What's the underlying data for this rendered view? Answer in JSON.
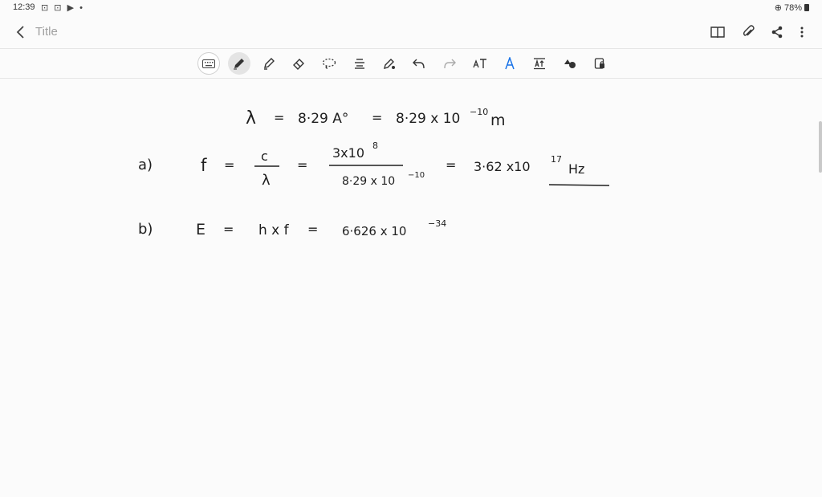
{
  "status_bar": {
    "time": "12:39",
    "notification_icons": [
      "screenshot-icon",
      "screenshot-icon",
      "play-store-icon",
      "dot"
    ],
    "battery_percent": "78%"
  },
  "header": {
    "title_placeholder": "Title",
    "icons": [
      "back-icon",
      "book-view-icon",
      "attach-icon",
      "share-icon",
      "more-icon"
    ]
  },
  "toolbar": {
    "tools": [
      "keyboard",
      "pen",
      "highlighter",
      "eraser",
      "lasso",
      "text-format",
      "pen-settings",
      "undo",
      "redo",
      "handwriting-to-text",
      "shape-recognition",
      "insert-space",
      "color-palette",
      "lock"
    ],
    "active_tool": "pen"
  },
  "note": {
    "line1": {
      "lhs": "λ",
      "eq1": "=",
      "value": "8·29 A°",
      "eq2": "=",
      "base": "8·29 x 10",
      "exp": "−10",
      "unit": "m"
    },
    "line_a": {
      "label": "a)",
      "lhs": "f",
      "eq1": "=",
      "frac_num": "c",
      "frac_den": "λ",
      "eq2": "=",
      "num_base": "3x10",
      "num_exp": "8",
      "den_base": "8·29 x 10",
      "den_exp": "−10",
      "eq3": "=",
      "result_base": "3·62 x10",
      "result_exp": "17",
      "result_unit": "Hz"
    },
    "line_b": {
      "label": "b)",
      "lhs": "E",
      "eq1": "=",
      "expr": "h x f",
      "eq2": "=",
      "base": "6·626 x 10",
      "exp": "−34"
    }
  }
}
